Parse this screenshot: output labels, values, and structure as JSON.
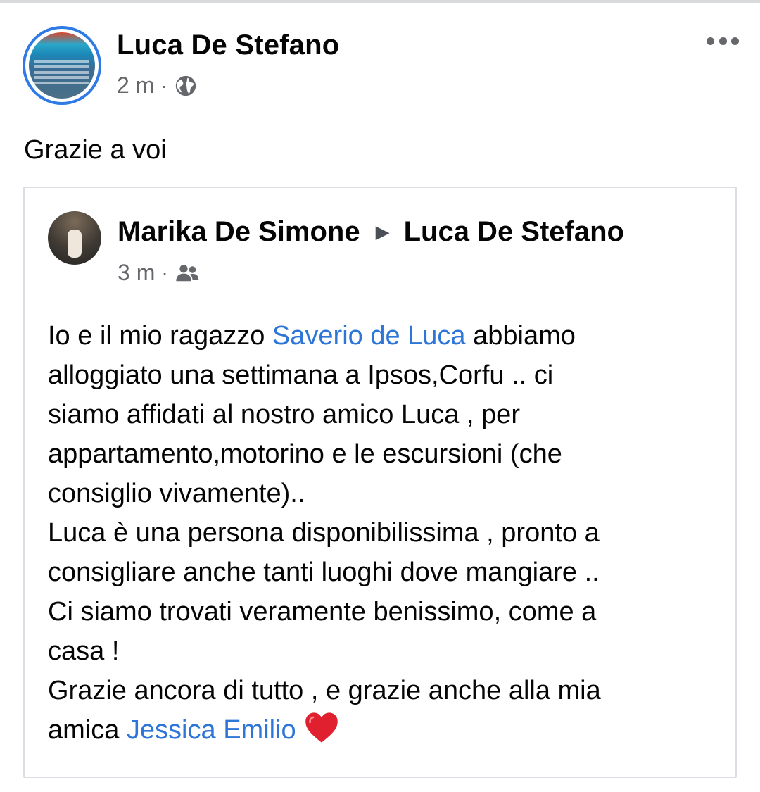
{
  "post": {
    "author": "Luca De Stefano",
    "time": "2 m",
    "separator": "·",
    "privacy_icon": "globe-icon",
    "more_icon": "more-options-icon",
    "text": "Grazie a voi"
  },
  "shared_post": {
    "author": "Marika De Simone",
    "arrow": "▶",
    "target": "Luca De Stefano",
    "time": "3 m",
    "separator": "·",
    "privacy_icon": "friends-icon",
    "body": {
      "line1_pre": "Io e il mio ragazzo ",
      "mention1": "Saverio de Luca",
      "line1_post": " abbiamo",
      "line2": "alloggiato una settimana a Ipsos,Corfu .. ci",
      "line3": "siamo affidati al nostro amico Luca , per",
      "line4": "appartamento,motorino e le escursioni (che",
      "line5": "consiglio vivamente)..",
      "line6": "Luca è una persona disponibilissima , pronto a",
      "line7": "consigliare anche tanti luoghi dove mangiare ..",
      "line8": "Ci siamo trovati veramente benissimo, come a",
      "line9": "casa !",
      "line10": "Grazie ancora di tutto , e grazie anche alla mia",
      "line11_pre": "amica ",
      "mention2": "Jessica Emilio",
      "emoji": "heart-icon"
    }
  },
  "colors": {
    "link": "#2d75d6",
    "secondary_text": "#65676b",
    "avatar_ring": "#2f7ae5",
    "heart": "#e0202f"
  }
}
